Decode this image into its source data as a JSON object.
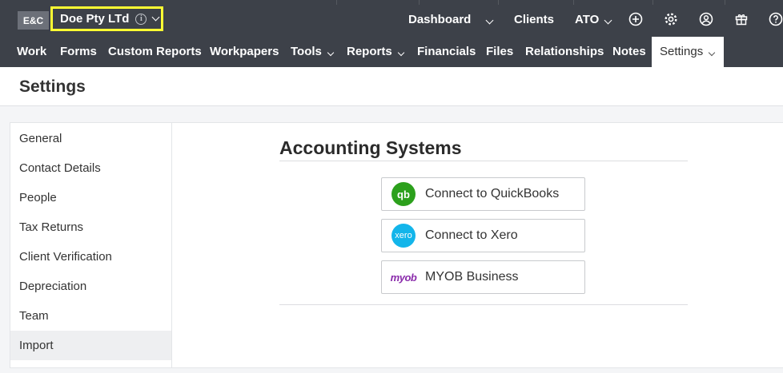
{
  "brand": {
    "logo_text": "E&C",
    "client_name": "Doe Pty LTd"
  },
  "header_links": {
    "dashboard": "Dashboard",
    "clients": "Clients",
    "ato": "ATO"
  },
  "header_icons": [
    "add-circle-icon",
    "gear-icon",
    "user-circle-icon",
    "gift-icon",
    "help-circle-icon"
  ],
  "nav": {
    "work": "Work",
    "forms": "Forms",
    "custom_reports": "Custom Reports",
    "workpapers": "Workpapers",
    "tools": "Tools",
    "reports": "Reports",
    "financials": "Financials",
    "files": "Files",
    "relationships": "Relationships",
    "notes": "Notes",
    "settings": "Settings"
  },
  "page": {
    "title": "Settings"
  },
  "sidebar": {
    "items": [
      {
        "label": "General"
      },
      {
        "label": "Contact Details"
      },
      {
        "label": "People"
      },
      {
        "label": "Tax Returns"
      },
      {
        "label": "Client Verification"
      },
      {
        "label": "Depreciation"
      },
      {
        "label": "Team"
      },
      {
        "label": "Import"
      }
    ],
    "active": "Import"
  },
  "accounting": {
    "title": "Accounting Systems",
    "buttons": [
      {
        "label": "Connect to QuickBooks",
        "logo_text": "qb"
      },
      {
        "label": "Connect to Xero",
        "logo_text": "xero"
      },
      {
        "label": "MYOB Business",
        "logo_text": "myob"
      }
    ]
  },
  "colors": {
    "topbar": "#3d4149",
    "highlight_border": "#ffff33",
    "quickbooks": "#2ca01c",
    "xero": "#13b5ea",
    "myob": "#8a2bab"
  }
}
